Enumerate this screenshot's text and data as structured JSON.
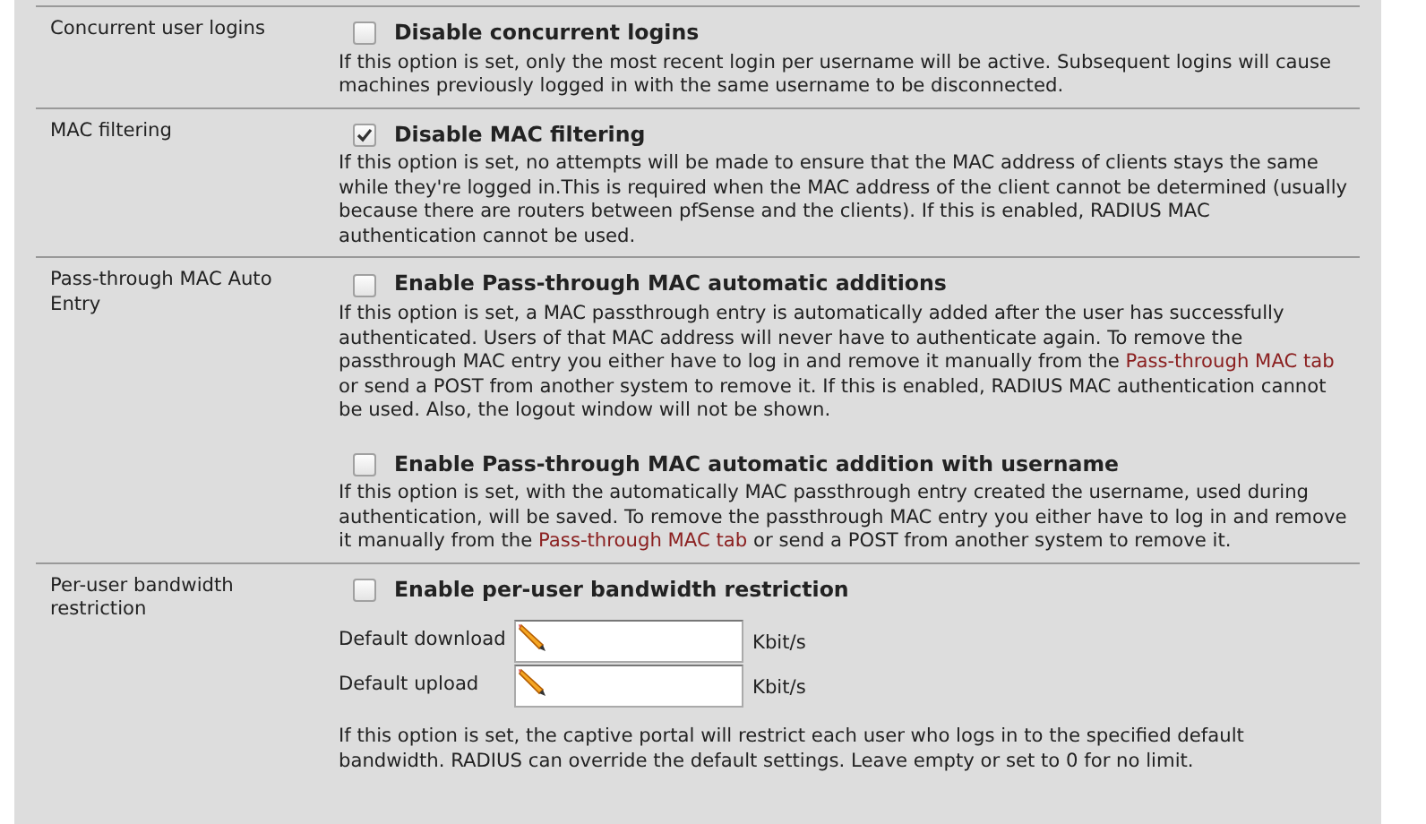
{
  "rows": [
    {
      "label": "Concurrent user logins",
      "options": [
        {
          "checked": false,
          "title": "Disable concurrent logins",
          "description": [
            {
              "kind": "text",
              "text": "If this option is set, only the most recent login per username will be active. Subsequent logins will cause machines previously logged in with the same username to be disconnected."
            }
          ]
        }
      ]
    },
    {
      "label": "MAC filtering",
      "options": [
        {
          "checked": true,
          "title": "Disable MAC filtering",
          "description": [
            {
              "kind": "text",
              "text": "If this option is set, no attempts will be made to ensure that the MAC address of clients stays the same while they're logged in.This is required when the MAC address of the client cannot be determined (usually because there are routers between pfSense and the clients). If this is enabled, RADIUS MAC authentication cannot be used."
            }
          ]
        }
      ]
    },
    {
      "label": "Pass-through MAC Auto Entry",
      "options": [
        {
          "checked": false,
          "title": "Enable Pass-through MAC automatic additions",
          "description": [
            {
              "kind": "text",
              "text": "If this option is set, a MAC passthrough entry is automatically added after the user has successfully authenticated. Users of that MAC address will never have to authenticate again. To remove the passthrough MAC entry you either have to log in and remove it manually from the"
            },
            {
              "kind": "link",
              "text": "Pass-through MAC tab"
            },
            {
              "kind": "text",
              "text": "or send a POST from another system to remove it. If this is enabled, RADIUS MAC authentication cannot be used. Also, the logout window will not be shown."
            }
          ]
        },
        {
          "checked": false,
          "title": "Enable Pass-through MAC automatic addition with username",
          "description": [
            {
              "kind": "text",
              "text": "If this option is set, with the automatically MAC passthrough entry created the username, used during authentication, will be saved. To remove the passthrough MAC entry you either have to log in and remove it manually from the"
            },
            {
              "kind": "link",
              "text": "Pass-through MAC tab"
            },
            {
              "kind": "text",
              "text": "or send a POST from another system to remove it."
            }
          ]
        }
      ]
    },
    {
      "label": "Per-user bandwidth restriction",
      "options": [
        {
          "checked": false,
          "title": "Enable per-user bandwidth restriction"
        }
      ],
      "fields": [
        {
          "label": "Default download",
          "unit": "Kbit/s"
        },
        {
          "label": "Default upload",
          "unit": "Kbit/s"
        }
      ],
      "note": "If this option is set, the captive portal will restrict each user who logs in to the specified default bandwidth. RADIUS can override the default settings. Leave empty or set to 0 for no limit."
    }
  ]
}
